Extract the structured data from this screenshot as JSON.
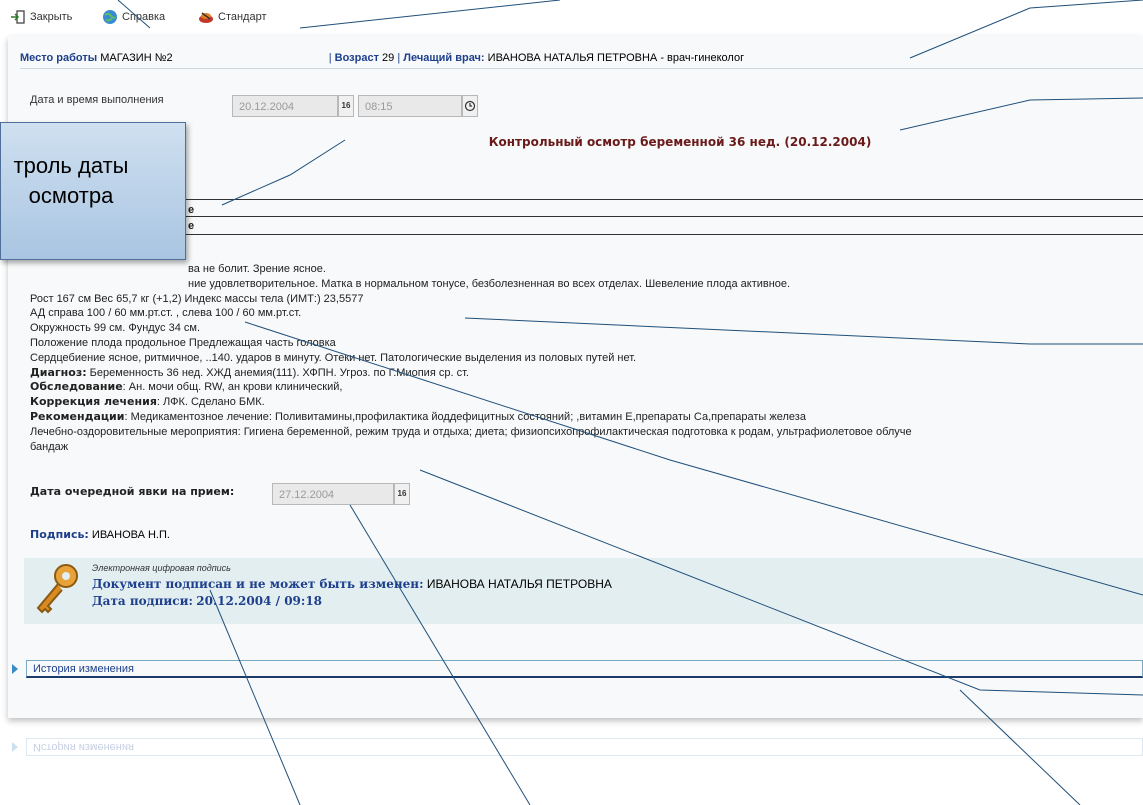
{
  "toolbar": {
    "close_label": "Закрыть",
    "help_label": "Справка",
    "standard_label": "Стандарт"
  },
  "info": {
    "workplace_label": "Место работы",
    "workplace_value": "МАГАЗИН №2",
    "age_label": "Возраст",
    "age_value": "29",
    "doctor_label": "Лечащий врач:",
    "doctor_value": "ИВАНОВА НАТАЛЬЯ ПЕТРОВНА - врач-гинеколог"
  },
  "exec": {
    "label": "Дата и время выполнения",
    "date_value": "20.12.2004",
    "calendar_icon_text": "16",
    "time_value": "08:15"
  },
  "exam_title": "Контрольный осмотр беременной 36 нед.  (20.12.2004)",
  "callout": {
    "line1": "троль даты",
    "line2": "осмотра"
  },
  "sections": {
    "cut1": "е",
    "cut2": "е"
  },
  "exam_lines": [
    {
      "label": "",
      "text": "ва не болит. Зрение ясное."
    },
    {
      "label": "",
      "text": "ние удовлетворительное. Матка в нормальном тонусе, безболезненная во всех отделах. Шевеление плода активное."
    },
    {
      "label": "",
      "text": "Рост 167 см  Вес 65,7 кг (+1,2) Индекс массы тела (ИМТ:) 23,5577"
    },
    {
      "label": "",
      "text": "АД справа 100 / 60  мм.рт.ст. , слева 100 / 60   мм.рт.ст."
    },
    {
      "label": "",
      "text": "Окружность 99 см. Фундус 34 см."
    },
    {
      "label": "",
      "text": "Положение плода продольное Предлежащая часть головка"
    },
    {
      "label": "",
      "text": "Сердцебиение ясное, ритмичное, ..140. ударов в минуту. Отеки нет. Патологические выделения из половых путей нет."
    },
    {
      "label": "Диагноз:",
      "text": " Беременность 36 нед. ХЖД анемия(111). ХФПН. Угроз. по Г.Миопия ср. ст."
    },
    {
      "label": "Обследование",
      "text": ": Ан. мочи общ. RW, ан крови клинический,"
    },
    {
      "label": "Коррекция лечения",
      "text": ": ЛФК. Сделано БМК."
    },
    {
      "label": "Рекомендации",
      "text": ": Медикаментозное лечение: Поливитамины,профилактика йоддефицитных состояний; ,витамин Е,препараты Са,препараты железа"
    },
    {
      "label": "",
      "text": "Лечебно-оздоровительные мероприятия: Гигиена беременной, режим труда и отдыха; диета; физиопсихопрофилактическая подготовка к родам, ультрафиолетовое облуче"
    },
    {
      "label": "",
      "text": "бандаж"
    }
  ],
  "next_visit": {
    "label": "Дата очередной явки на прием:",
    "value": "27.12.2004",
    "calendar_icon_text": "16"
  },
  "signature": {
    "label": "Подпись:",
    "value": "ИВАНОВА Н.П."
  },
  "esign": {
    "caption": "Электронная цифровая подпись",
    "signed_label": "Документ подписан и не может быть изменен:",
    "signed_by": "ИВАНОВА НАТАЛЬЯ ПЕТРОВНА",
    "date_label": "Дата подписи:",
    "date_value": "20.12.2004 / 09:18"
  },
  "history": {
    "label": "История изменения",
    "reflection_label": "История изменения"
  },
  "colors": {
    "label_blue": "#1d3f8c",
    "title_red": "#6b1a1a",
    "esign_bg": "#e3eef1",
    "callout_bg": "#b7cfe8"
  }
}
